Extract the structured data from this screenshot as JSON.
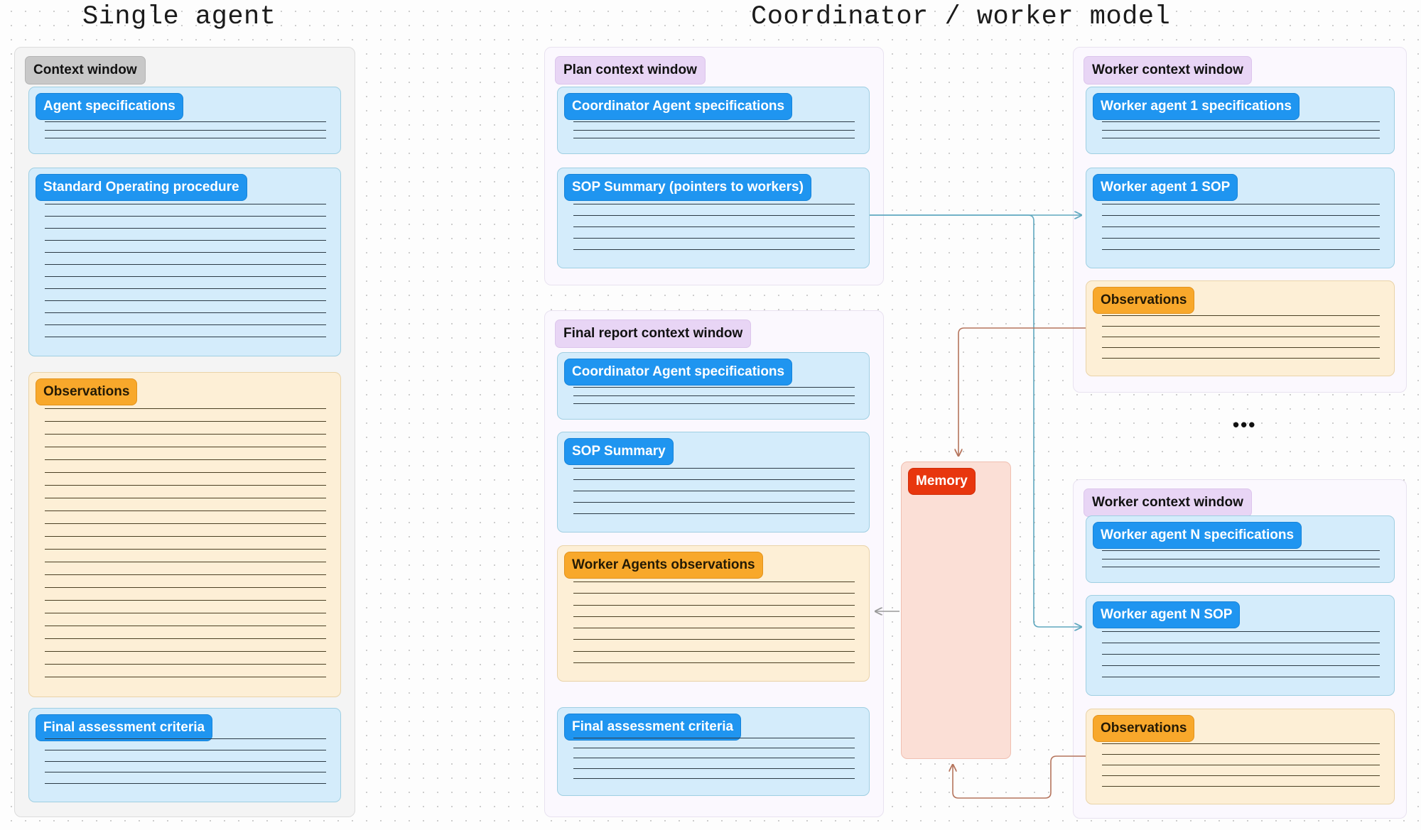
{
  "titles": {
    "left": "Single agent",
    "right": "Coordinator / worker model"
  },
  "panels": {
    "context_window": {
      "label": "Context window"
    },
    "plan_context_window": {
      "label": "Plan context window"
    },
    "final_report_context_window": {
      "label": "Final report context window"
    },
    "worker_context_window_1": {
      "label": "Worker context window"
    },
    "worker_context_window_n": {
      "label": "Worker context window"
    }
  },
  "cards": {
    "agent_specifications": {
      "label": "Agent specifications",
      "lines": 3
    },
    "standard_operating_procedure": {
      "label": "Standard Operating procedure",
      "lines": 12
    },
    "observations_single": {
      "label": "Observations",
      "lines": 22
    },
    "final_assessment_criteria_single": {
      "label": "Final assessment criteria",
      "lines": 5
    },
    "coordinator_agent_specifications_plan": {
      "label": "Coordinator Agent specifications",
      "lines": 3
    },
    "sop_summary_pointers": {
      "label": "SOP Summary (pointers to workers)",
      "lines": 5
    },
    "coordinator_agent_specifications_final": {
      "label": "Coordinator Agent specifications",
      "lines": 3
    },
    "sop_summary": {
      "label": "SOP Summary",
      "lines": 5
    },
    "worker_agents_observations": {
      "label": "Worker Agents observations",
      "lines": 8
    },
    "final_assessment_criteria_final": {
      "label": "Final assessment criteria",
      "lines": 5
    },
    "memory": {
      "label": "Memory",
      "lines": 0
    },
    "worker_agent_1_specifications": {
      "label": "Worker agent 1 specifications",
      "lines": 3
    },
    "worker_agent_1_sop": {
      "label": "Worker agent 1 SOP",
      "lines": 5
    },
    "observations_worker_1": {
      "label": "Observations",
      "lines": 5
    },
    "worker_agent_n_specifications": {
      "label": "Worker agent N specifications",
      "lines": 3
    },
    "worker_agent_n_sop": {
      "label": "Worker agent N SOP",
      "lines": 5
    },
    "observations_worker_n": {
      "label": "Observations",
      "lines": 5
    }
  },
  "separator": {
    "ellipsis": "•••"
  },
  "colors": {
    "blue_pill": "#1f95f0",
    "orange_pill": "#f8a82b",
    "red_pill": "#e8360e",
    "lilac_chip": "#e8d5f5",
    "grey_chip": "#c8c8c8",
    "blue_card": "#d4ecfb",
    "amber_card": "#fdefd6",
    "pink_card": "#fbdfd6",
    "wire_teal": "#5fa8bf",
    "wire_brown": "#b5745c",
    "wire_grey": "#9a9a9a"
  }
}
